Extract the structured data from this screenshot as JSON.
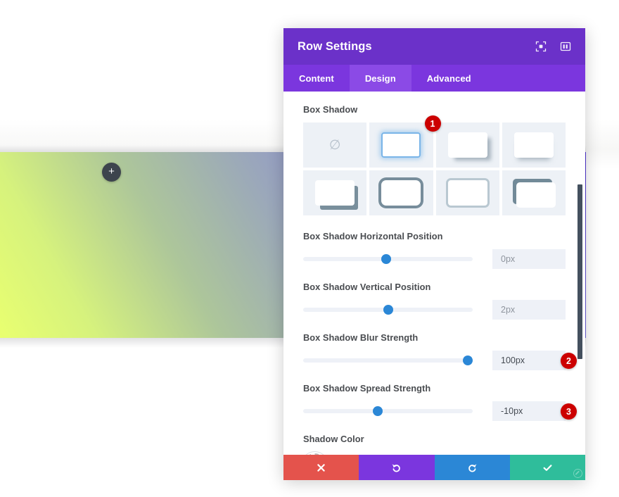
{
  "page": {
    "add_row_icon": "plus-icon"
  },
  "modal": {
    "title": "Row Settings",
    "header_icons": [
      {
        "name": "fullscreen-icon"
      },
      {
        "name": "layout-panel-icon"
      }
    ],
    "tabs": [
      {
        "label": "Content",
        "active": false
      },
      {
        "label": "Design",
        "active": true
      },
      {
        "label": "Advanced",
        "active": false
      }
    ],
    "box_shadow": {
      "label": "Box Shadow",
      "presets": [
        {
          "name": "preset-none",
          "style": "none",
          "selected": false
        },
        {
          "name": "preset-selected",
          "style": "sel",
          "selected": true
        },
        {
          "name": "preset-right",
          "style": "right",
          "selected": false
        },
        {
          "name": "preset-bottom",
          "style": "bottom",
          "selected": false
        },
        {
          "name": "preset-corner",
          "style": "corner",
          "selected": false
        },
        {
          "name": "preset-thick-outline",
          "style": "thick",
          "selected": false
        },
        {
          "name": "preset-soft-outline",
          "style": "soft",
          "selected": false
        },
        {
          "name": "preset-bracket",
          "style": "bracket",
          "selected": false
        }
      ]
    },
    "sliders": [
      {
        "label": "Box Shadow Horizontal Position",
        "value": "0px",
        "percent": 49
      },
      {
        "label": "Box Shadow Vertical Position",
        "value": "2px",
        "percent": 50
      },
      {
        "label": "Box Shadow Blur Strength",
        "value": "100px",
        "percent": 97
      },
      {
        "label": "Box Shadow Spread Strength",
        "value": "-10px",
        "percent": 44
      }
    ],
    "shadow_color": {
      "label": "Shadow Color",
      "picker_icon": "eyedropper-icon",
      "swatches": [
        {
          "name": "swatch-black",
          "hex": "#000000"
        },
        {
          "name": "swatch-white",
          "hex": "#ffffff"
        },
        {
          "name": "swatch-red",
          "hex": "#e32222"
        },
        {
          "name": "swatch-orange",
          "hex": "#e8950c"
        },
        {
          "name": "swatch-yellow",
          "hex": "#eae320"
        },
        {
          "name": "swatch-green",
          "hex": "#5ec72c"
        },
        {
          "name": "swatch-blue",
          "hex": "#176cc0"
        },
        {
          "name": "swatch-purple",
          "hex": "#8c14d6"
        },
        {
          "name": "swatch-transparent",
          "hex": "transparent"
        }
      ]
    },
    "footer": [
      {
        "name": "cancel-button",
        "icon": "close-icon",
        "color": "#e4534c"
      },
      {
        "name": "undo-button",
        "icon": "undo-icon",
        "color": "#7b36de"
      },
      {
        "name": "redo-button",
        "icon": "redo-icon",
        "color": "#2b87d6"
      },
      {
        "name": "save-button",
        "icon": "check-icon",
        "color": "#2fbd9b"
      }
    ]
  },
  "annotations": [
    {
      "number": "1",
      "target": "preset-selected"
    },
    {
      "number": "2",
      "target": "blur-strength-value"
    },
    {
      "number": "3",
      "target": "spread-strength-value"
    }
  ]
}
